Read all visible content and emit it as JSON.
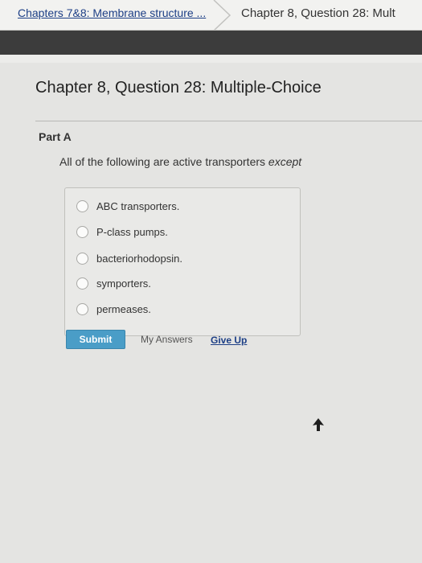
{
  "breadcrumb": {
    "parent_label": "Chapters 7&8: Membrane structure ...",
    "current_label": "Chapter 8, Question 28: Mult"
  },
  "page": {
    "title": "Chapter 8, Question 28: Multiple-Choice"
  },
  "part": {
    "title": "Part A",
    "question_text": "All of the following are active transporters ",
    "question_emphasis": "except"
  },
  "choices": [
    {
      "label": "ABC transporters.",
      "selected": false
    },
    {
      "label": "P-class pumps.",
      "selected": false
    },
    {
      "label": "bacteriorhodopsin.",
      "selected": false
    },
    {
      "label": "symporters.",
      "selected": false
    },
    {
      "label": "permeases.",
      "selected": false
    }
  ],
  "actions": {
    "submit_label": "Submit",
    "my_answers_label": "My Answers",
    "give_up_label": "Give Up"
  },
  "colors": {
    "link": "#1d3f86",
    "submit": "#4a9dc7",
    "header_band": "#3c3c3c"
  }
}
